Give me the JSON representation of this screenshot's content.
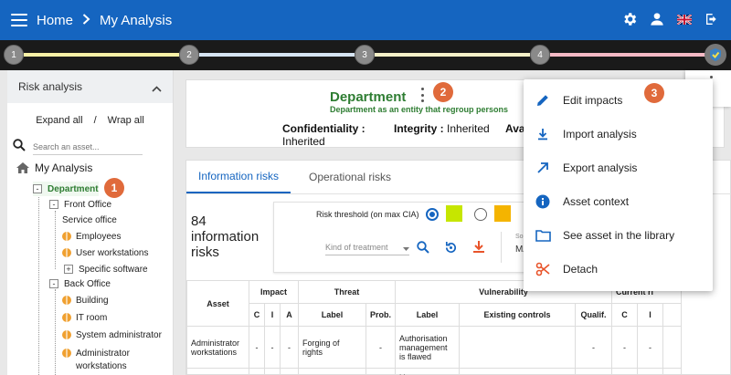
{
  "header": {
    "breadcrumb_home": "Home",
    "breadcrumb_current": "My Analysis"
  },
  "stepper": {
    "steps": [
      "1",
      "2",
      "3",
      "4"
    ],
    "segment_colors": [
      "#f7f0a6",
      "#d6e4f2",
      "#f5f0c8",
      "#f4b9c5"
    ]
  },
  "sidebar": {
    "title": "Risk analysis",
    "expand_all": "Expand all",
    "separator": "/",
    "wrap_all": "Wrap all",
    "search_placeholder": "Search an asset...",
    "root_label": "My Analysis",
    "items": [
      {
        "label": "Department",
        "type": "group",
        "selected": true
      },
      {
        "label": "Front Office",
        "type": "group"
      },
      {
        "label": "Service office",
        "type": "leaf"
      },
      {
        "label": "Employees",
        "type": "globe"
      },
      {
        "label": "User workstations",
        "type": "globe"
      },
      {
        "label": "Specific software",
        "type": "expandable"
      },
      {
        "label": "Back Office",
        "type": "group"
      },
      {
        "label": "Building",
        "type": "globe"
      },
      {
        "label": "IT room",
        "type": "globe"
      },
      {
        "label": "System administrator",
        "type": "globe"
      },
      {
        "label": "Administrator",
        "type": "globe"
      },
      {
        "label": "workstations",
        "type": "text"
      }
    ]
  },
  "callouts": [
    "1",
    "2",
    "3"
  ],
  "department": {
    "title": "Department",
    "subtitle": "Department as an entity that regroup persons",
    "confidentiality_label": "Confidentiality :",
    "confidentiality_value": "Inherited",
    "integrity_label": "Integrity :",
    "integrity_value": "Inherited",
    "availability_label": "Ava"
  },
  "tabs": [
    {
      "label": "Information risks",
      "active": true
    },
    {
      "label": "Operational risks",
      "active": false
    }
  ],
  "risks_count": {
    "number": "84",
    "line1": "information",
    "line2": "risks"
  },
  "filter": {
    "threshold_label": "Risk threshold (on max CIA)",
    "threshold_colors": [
      "#c6e600",
      "#f4b400"
    ],
    "treatment_placeholder": "Kind of treatment",
    "sort_label": "So",
    "sort_value": "MA"
  },
  "table": {
    "group_headers": {
      "asset": "Asset",
      "impact": "Impact",
      "threat": "Threat",
      "vulnerability": "Vulnerability",
      "current": "Current ri"
    },
    "sub_headers": {
      "c": "C",
      "i": "I",
      "a": "A",
      "label": "Label",
      "prob": "Prob.",
      "vlabel": "Label",
      "existing": "Existing controls",
      "qualif": "Qualif.",
      "rc": "C",
      "ri": "I"
    },
    "rows": [
      {
        "asset": "Administrator workstations",
        "c": "-",
        "i": "-",
        "a": "-",
        "threat": "Forging of rights",
        "prob": "-",
        "vuln": "Authorisation management is flawed",
        "existing": "",
        "qualif": "-",
        "rc": "-",
        "ri": "-"
      },
      {
        "asset": "",
        "c": "",
        "i": "",
        "a": "",
        "threat": "",
        "prob": "",
        "vuln": "U",
        "existing": "",
        "qualif": "",
        "rc": "",
        "ri": ""
      }
    ]
  },
  "menu": {
    "items": [
      {
        "label": "Edit impacts",
        "icon": "pencil-icon"
      },
      {
        "label": "Import analysis",
        "icon": "download-arrow-icon"
      },
      {
        "label": "Export analysis",
        "icon": "export-arrow-icon"
      },
      {
        "label": "Asset context",
        "icon": "info-icon"
      },
      {
        "label": "See asset in the library",
        "icon": "folder-icon"
      },
      {
        "label": "Detach",
        "icon": "scissors-icon"
      }
    ]
  }
}
